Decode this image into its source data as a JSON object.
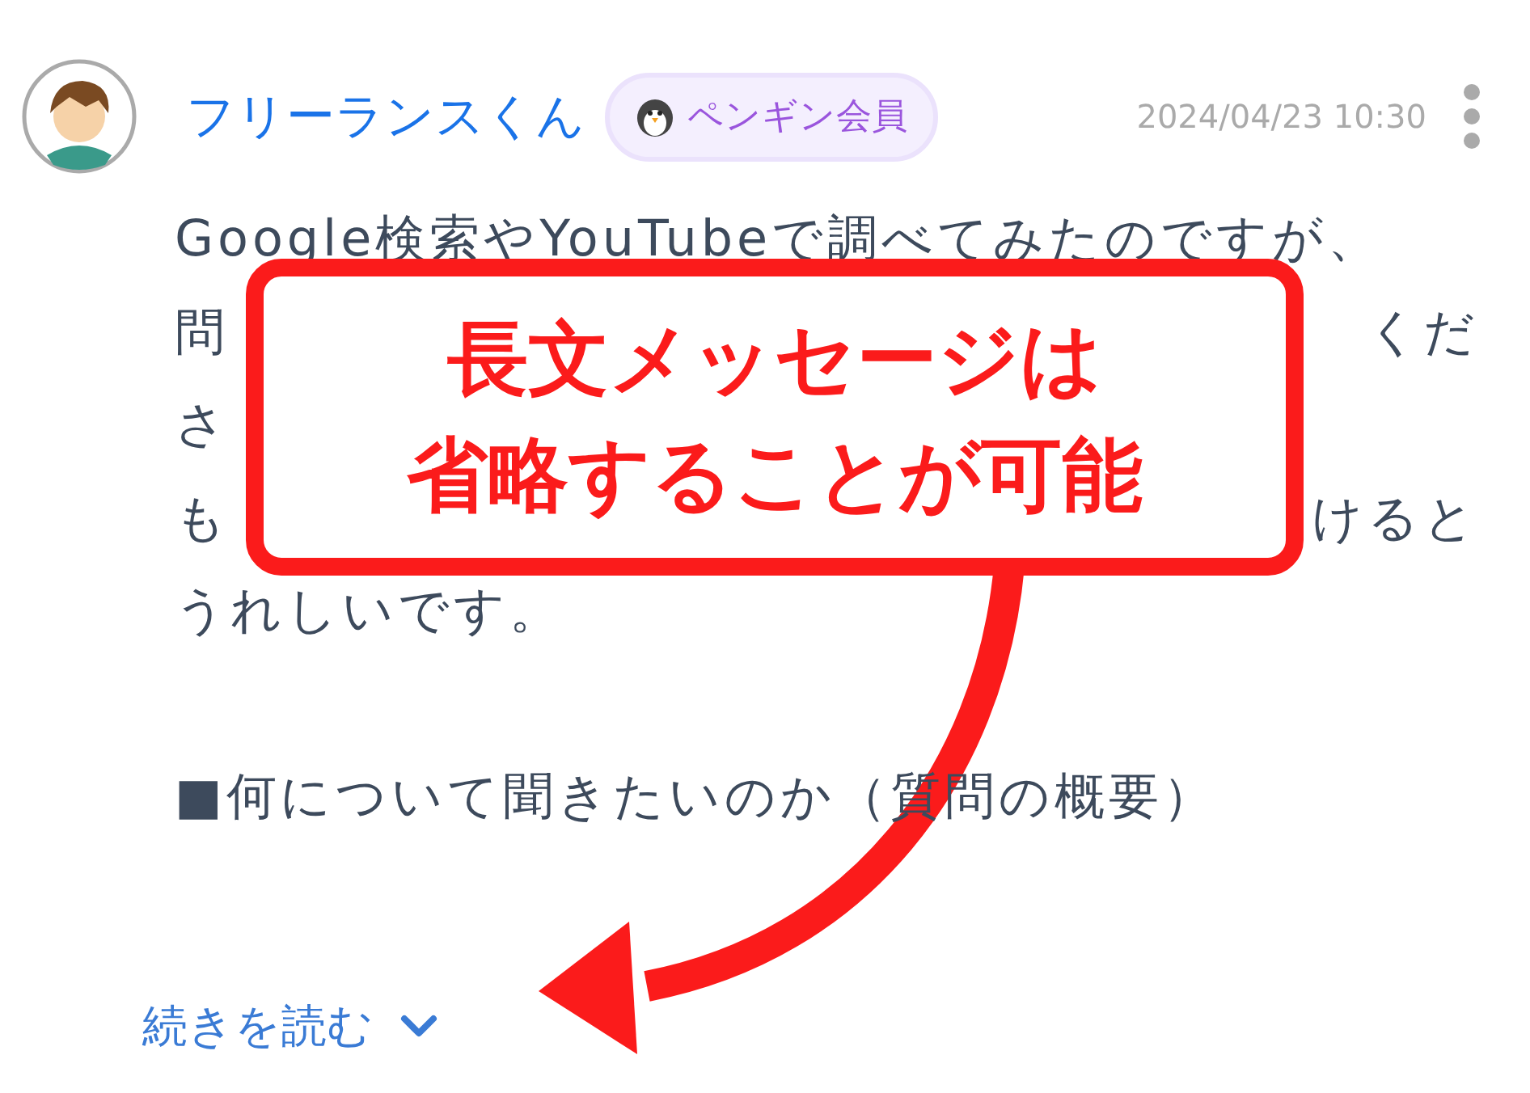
{
  "post": {
    "author": "フリーランスくん",
    "badge": {
      "label": "ペンギン会員"
    },
    "timestamp": "2024/04/23 10:30",
    "body_lines": [
      {
        "left": "Google検索やYouTubeで調べてみたのですが、"
      },
      {
        "left": "問",
        "right": "くだ"
      },
      {
        "left": "さ"
      },
      {
        "left": "も",
        "right": "けると"
      },
      {
        "left": "うれしいです。"
      }
    ],
    "heading": "■何について聞きたいのか（質問の概要）",
    "read_more": "続きを読む"
  },
  "callout": {
    "lines": [
      "長文メッセージは",
      "省略することが可能"
    ]
  }
}
